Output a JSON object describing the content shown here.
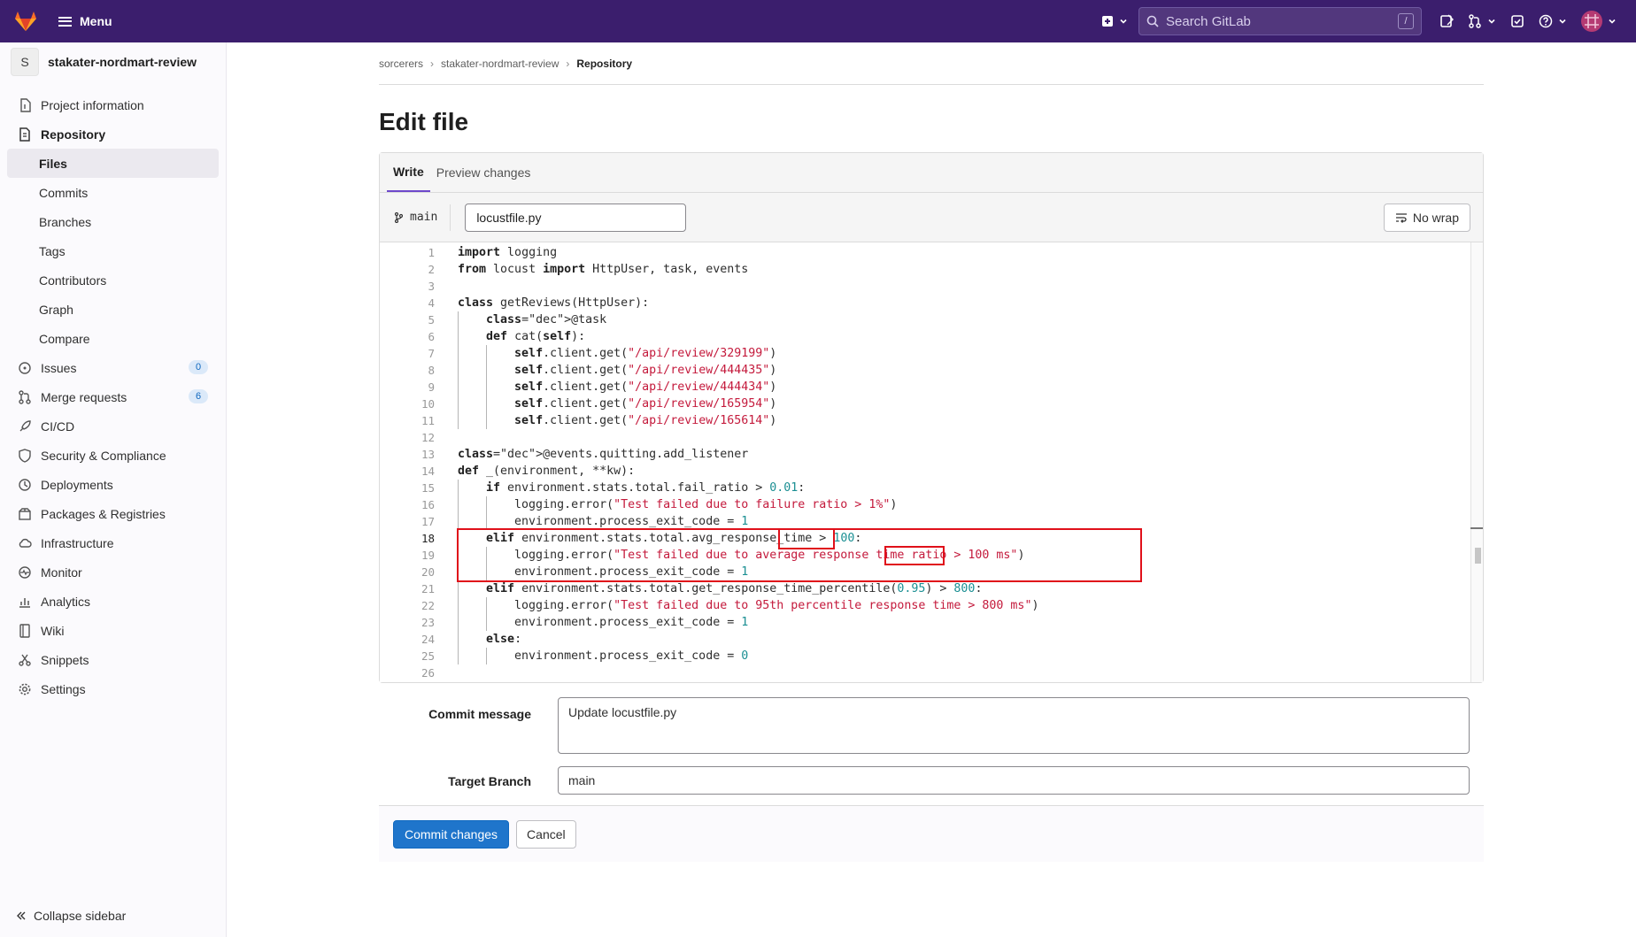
{
  "topbar": {
    "menu_label": "Menu",
    "search_placeholder": "Search GitLab",
    "search_shortcut": "/"
  },
  "sidebar": {
    "project_initial": "S",
    "project_name": "stakater-nordmart-review",
    "items": [
      {
        "label": "Project information",
        "icon": "info-icon"
      },
      {
        "label": "Repository",
        "icon": "document-icon"
      },
      {
        "label": "Files"
      },
      {
        "label": "Commits"
      },
      {
        "label": "Branches"
      },
      {
        "label": "Tags"
      },
      {
        "label": "Contributors"
      },
      {
        "label": "Graph"
      },
      {
        "label": "Compare"
      },
      {
        "label": "Issues",
        "icon": "issues-icon",
        "badge": "0"
      },
      {
        "label": "Merge requests",
        "icon": "merge-request-icon",
        "badge": "6"
      },
      {
        "label": "CI/CD",
        "icon": "rocket-icon"
      },
      {
        "label": "Security & Compliance",
        "icon": "shield-icon"
      },
      {
        "label": "Deployments",
        "icon": "deployments-icon"
      },
      {
        "label": "Packages & Registries",
        "icon": "package-icon"
      },
      {
        "label": "Infrastructure",
        "icon": "cloud-icon"
      },
      {
        "label": "Monitor",
        "icon": "monitor-icon"
      },
      {
        "label": "Analytics",
        "icon": "chart-icon"
      },
      {
        "label": "Wiki",
        "icon": "book-icon"
      },
      {
        "label": "Snippets",
        "icon": "scissors-icon"
      },
      {
        "label": "Settings",
        "icon": "gear-icon"
      }
    ],
    "collapse_label": "Collapse sidebar"
  },
  "breadcrumb": [
    "sorcerers",
    "stakater-nordmart-review",
    "Repository"
  ],
  "page_title": "Edit file",
  "editor": {
    "tabs": [
      "Write",
      "Preview changes"
    ],
    "branch": "main",
    "file_name": "locustfile.py",
    "wrap_button": "No wrap",
    "current_line": 18
  },
  "code_lines": [
    "import logging",
    "from locust import HttpUser, task, events",
    "",
    "class getReviews(HttpUser):",
    "    @task",
    "    def cat(self):",
    "        self.client.get(\"/api/review/329199\")",
    "        self.client.get(\"/api/review/444435\")",
    "        self.client.get(\"/api/review/444434\")",
    "        self.client.get(\"/api/review/165954\")",
    "        self.client.get(\"/api/review/165614\")",
    "",
    "@events.quitting.add_listener",
    "def _(environment, **kw):",
    "    if environment.stats.total.fail_ratio > 0.01:",
    "        logging.error(\"Test failed due to failure ratio > 1%\")",
    "        environment.process_exit_code = 1",
    "    elif environment.stats.total.avg_response_time > 100:",
    "        logging.error(\"Test failed due to average response time ratio > 100 ms\")",
    "        environment.process_exit_code = 1",
    "    elif environment.stats.total.get_response_time_percentile(0.95) > 800:",
    "        logging.error(\"Test failed due to 95th percentile response time > 800 ms\")",
    "        environment.process_exit_code = 1",
    "    else:",
    "        environment.process_exit_code = 0",
    ""
  ],
  "form": {
    "commit_label": "Commit message",
    "commit_value": "Update locustfile.py",
    "branch_label": "Target Branch",
    "branch_value": "main"
  },
  "actions": {
    "commit": "Commit changes",
    "cancel": "Cancel"
  },
  "colors": {
    "topbar": "#3b1e6d",
    "primary": "#1f75cb",
    "annotation": "#e0101a"
  }
}
